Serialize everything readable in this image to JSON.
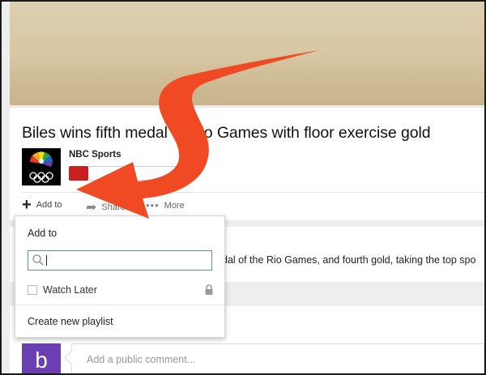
{
  "video": {
    "title": "Biles wins fifth medal of Rio Games with floor exercise gold",
    "channel_name": "NBC Sports"
  },
  "actions": {
    "add_to_label": "Add to",
    "share_label": "Share",
    "more_label": "More"
  },
  "description": {
    "text_fragment": "dal of the Rio Games, and fourth gold, taking the top spo"
  },
  "popup": {
    "title": "Add to",
    "search_value": "",
    "watch_later_label": "Watch Later",
    "watch_later_checked": false,
    "create_playlist_label": "Create new playlist"
  },
  "comment": {
    "avatar_letter": "b",
    "placeholder": "Add a public comment..."
  },
  "colors": {
    "annotation_arrow": "#f04a25",
    "avatar_bg": "#6a3fb2",
    "subscribe_red": "#cc1f1f",
    "search_border": "#5a8ec9"
  },
  "icons": {
    "add": "plus-icon",
    "share": "share-arrow-icon",
    "more": "three-dots-icon",
    "search": "magnifier-icon",
    "private": "lock-icon",
    "channel_logo": "nbc-peacock-olympic-rings-logo"
  }
}
